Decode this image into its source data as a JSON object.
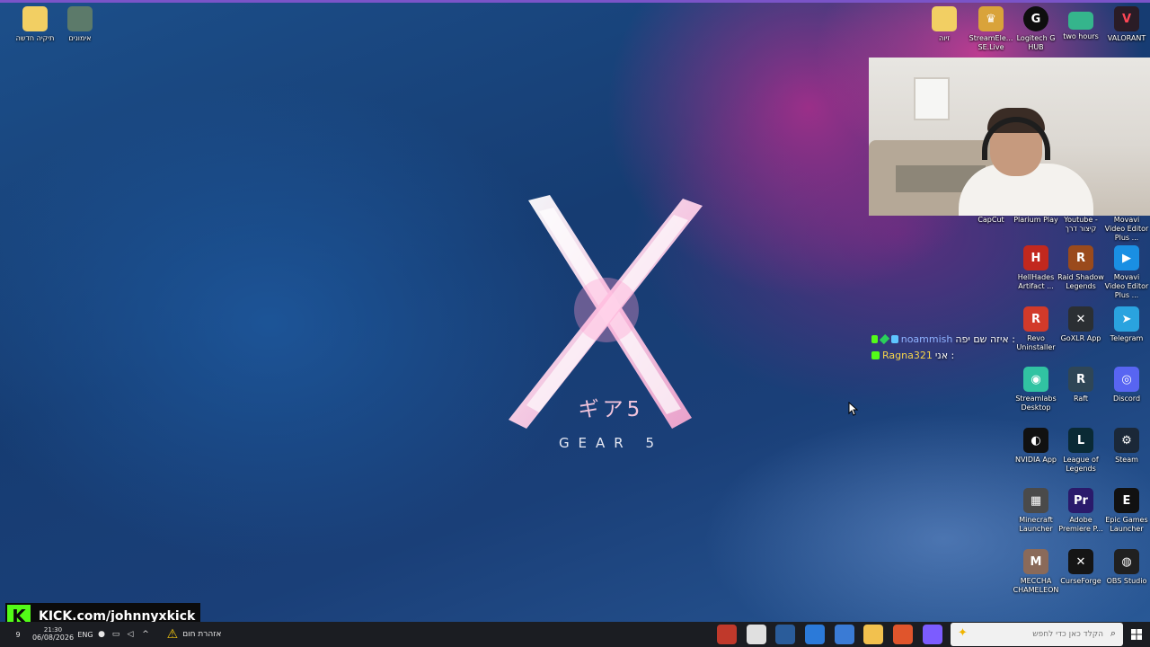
{
  "wallpaper": {
    "title_jp": "ギア5",
    "title": "GEAR 5"
  },
  "desktop_left": [
    {
      "label": "תיקיה חדשה",
      "icon": "folder-icon"
    },
    {
      "label": "אימונים",
      "icon": "folder-icon"
    }
  ],
  "desktop_right_top": [
    {
      "label": "זיוה",
      "icon": "folder-icon"
    },
    {
      "label": "StreamEle... SE.Live",
      "icon": "streamelements-icon"
    },
    {
      "label": "Logitech G HUB",
      "icon": "logitech-icon"
    },
    {
      "label": "two hours",
      "icon": "image-file-icon"
    },
    {
      "label": "VALORANT",
      "icon": "valorant-icon"
    }
  ],
  "desktop_right_row2": [
    {
      "label": "CapCut",
      "icon": "capcut-icon"
    },
    {
      "label": "Plarium Play",
      "icon": "plarium-icon"
    },
    {
      "label": "Youtube - קיצור דרך",
      "icon": "youtube-icon"
    },
    {
      "label": "Movavi Video Editor Plus ...",
      "icon": "movavi-icon"
    }
  ],
  "desktop_grid": [
    {
      "label": "HellHades Artifact ...",
      "icon": "hellhades-icon",
      "color": "#c2281e",
      "glyph": "H"
    },
    {
      "label": "Raid Shadow Legends",
      "icon": "raid-icon",
      "color": "#9a4a1c",
      "glyph": "R"
    },
    {
      "label": "Movavi Video Editor Plus ...",
      "icon": "movavi-icon",
      "color": "#1a8fe3",
      "glyph": "▶"
    },
    {
      "label": "Revo Uninstaller",
      "icon": "revo-icon",
      "color": "#d23a2a",
      "glyph": "R"
    },
    {
      "label": "GoXLR App",
      "icon": "goxlr-icon",
      "color": "#2b2f33",
      "glyph": "✕"
    },
    {
      "label": "Telegram",
      "icon": "telegram-icon",
      "color": "#2aa3df",
      "glyph": "➤"
    },
    {
      "label": "Streamlabs Desktop",
      "icon": "streamlabs-icon",
      "color": "#31c3a2",
      "glyph": "◉"
    },
    {
      "label": "Raft",
      "icon": "raft-icon",
      "color": "#2f4656",
      "glyph": "R"
    },
    {
      "label": "Discord",
      "icon": "discord-icon",
      "color": "#5865f2",
      "glyph": "◎"
    },
    {
      "label": "NVIDIA App",
      "icon": "nvidia-icon",
      "color": "#111111",
      "glyph": "◐"
    },
    {
      "label": "League of Legends",
      "icon": "league-icon",
      "color": "#0a2a35",
      "glyph": "L"
    },
    {
      "label": "Steam",
      "icon": "steam-icon",
      "color": "#1b2838",
      "glyph": "⚙"
    },
    {
      "label": "Minecraft Launcher",
      "icon": "minecraft-icon",
      "color": "#4a4a4a",
      "glyph": "▦"
    },
    {
      "label": "Adobe Premiere P...",
      "icon": "premiere-icon",
      "color": "#2a1a6b",
      "glyph": "Pr"
    },
    {
      "label": "Epic Games Launcher",
      "icon": "epic-icon",
      "color": "#111111",
      "glyph": "E"
    },
    {
      "label": "MECCHA CHAMELEON",
      "icon": "meccha-icon",
      "color": "#8a6a5a",
      "glyph": "M"
    },
    {
      "label": "CurseForge",
      "icon": "curseforge-icon",
      "color": "#151515",
      "glyph": "✕"
    },
    {
      "label": "OBS Studio",
      "icon": "obs-icon",
      "color": "#202020",
      "glyph": "◍"
    }
  ],
  "chat": [
    {
      "user": "noammish",
      "message": "איזה שם יפה :"
    },
    {
      "user": "Ragna321",
      "message": "אני :"
    }
  ],
  "kick": {
    "logo": "K",
    "url": "KICK.com/johnnyxkick"
  },
  "taskbar": {
    "clock_time": "21:30",
    "clock_date": "06/08/2026",
    "notification_count": "9",
    "language": "ENG",
    "weather_text": "אזהרת חום",
    "search_placeholder": "הקלד כאן כדי לחפש",
    "apps": [
      {
        "icon": "record-app-icon",
        "color": "#c0392b"
      },
      {
        "icon": "chrome-icon",
        "color": "#e0e0e0"
      },
      {
        "icon": "steam-taskbar-icon",
        "color": "#2a5c9a"
      },
      {
        "icon": "mail-app-icon",
        "color": "#2b7ad9"
      },
      {
        "icon": "store-icon",
        "color": "#3a7bd5"
      },
      {
        "icon": "file-explorer-icon",
        "color": "#f2c14e"
      },
      {
        "icon": "office-app-icon",
        "color": "#e0552c"
      },
      {
        "icon": "copilot-icon",
        "color": "#7c5cff"
      }
    ]
  }
}
